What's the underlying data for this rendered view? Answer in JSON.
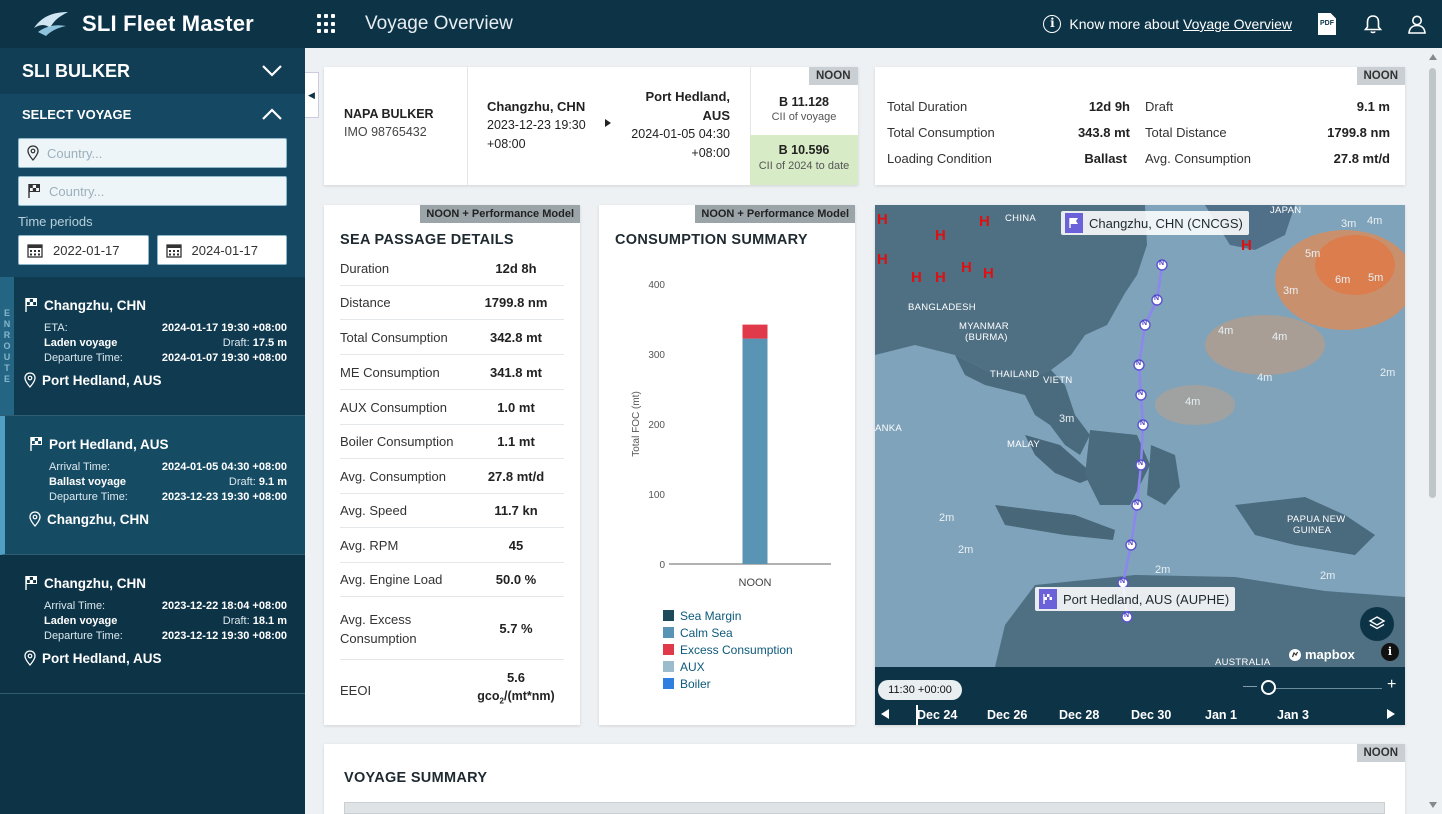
{
  "app": {
    "name": "SLI Fleet Master",
    "page_title": "Voyage Overview",
    "know_more_prefix": "Know more about",
    "know_more_link": "Voyage Overview",
    "pdf_label": "PDF"
  },
  "sidebar": {
    "vessel": "SLI BULKER",
    "select_voyage": "SELECT VOYAGE",
    "country_placeholder_1": "Country...",
    "country_placeholder_2": "Country...",
    "time_periods_label": "Time periods",
    "date_from": "2022-01-17",
    "date_to": "2024-01-17",
    "enroute_letters": [
      "E",
      "N",
      "R",
      "O",
      "U",
      "T",
      "E"
    ],
    "voyages": [
      {
        "origin": "Changzhu, CHN",
        "row1_label": "ETA:",
        "row1_value": "2024-01-17 19:30 +08:00",
        "condition": "Laden voyage",
        "draft_label": "Draft:",
        "draft_value": "17.5 m",
        "dep_label": "Departure Time:",
        "dep_value": "2024-01-07 19:30 +08:00",
        "destination": "Port Hedland, AUS"
      },
      {
        "origin": "Port Hedland, AUS",
        "row1_label": "Arrival Time:",
        "row1_value": "2024-01-05 04:30 +08:00",
        "condition": "Ballast voyage",
        "draft_label": "Draft:",
        "draft_value": "9.1 m",
        "dep_label": "Departure Time:",
        "dep_value": "2023-12-23 19:30 +08:00",
        "destination": "Changzhu, CHN"
      },
      {
        "origin": "Changzhu, CHN",
        "row1_label": "Arrival Time:",
        "row1_value": "2023-12-22 18:04 +08:00",
        "condition": "Laden voyage",
        "draft_label": "Draft:",
        "draft_value": "18.1 m",
        "dep_label": "Departure Time:",
        "dep_value": "2023-12-12 19:30 +08:00",
        "destination": "Port Hedland, AUS"
      }
    ]
  },
  "voyage_header": {
    "tag": "NOON",
    "ship_name": "NAPA BULKER",
    "imo": "IMO 98765432",
    "from_port": "Changzhu, CHN",
    "from_time": "2023-12-23 19:30",
    "from_tz": "+08:00",
    "to_port_1": "Port Hedland,",
    "to_port_2": "AUS",
    "to_time": "2024-01-05 04:30",
    "to_tz": "+08:00",
    "cii_voyage_value": "B 11.128",
    "cii_voyage_label": "CII of voyage",
    "cii_year_value": "B 10.596",
    "cii_year_label": "CII of 2024 to date"
  },
  "summary": {
    "tag": "NOON",
    "total_duration_label": "Total Duration",
    "total_duration": "12d 9h",
    "draft_label": "Draft",
    "draft": "9.1 m",
    "total_consumption_label": "Total Consumption",
    "total_consumption": "343.8 mt",
    "total_distance_label": "Total Distance",
    "total_distance": "1799.8 nm",
    "loading_condition_label": "Loading Condition",
    "loading_condition": "Ballast",
    "avg_consumption_label": "Avg. Consumption",
    "avg_consumption": "27.8 mt/d"
  },
  "sea_passage": {
    "tag": "NOON + Performance Model",
    "title": "SEA PASSAGE DETAILS",
    "rows": [
      {
        "label": "Duration",
        "value": "12d 8h"
      },
      {
        "label": "Distance",
        "value": "1799.8 nm"
      },
      {
        "label": "Total Consumption",
        "value": "342.8 mt"
      },
      {
        "label": "ME Consumption",
        "value": "341.8 mt"
      },
      {
        "label": "AUX Consumption",
        "value": "1.0 mt"
      },
      {
        "label": "Boiler Consumption",
        "value": "1.1 mt"
      },
      {
        "label": "Avg. Consumption",
        "value": "27.8 mt/d"
      },
      {
        "label": "Avg. Speed",
        "value": "11.7 kn"
      },
      {
        "label": "Avg. RPM",
        "value": "45"
      },
      {
        "label": "Avg. Engine Load",
        "value": "50.0 %"
      },
      {
        "label": "Avg. Excess Consumption",
        "value": "5.7 %"
      }
    ],
    "eeoi_label": "EEOI",
    "eeoi_value": "5.6",
    "eeoi_unit_a": "gco",
    "eeoi_unit_sub": "2",
    "eeoi_unit_b": "/(mt*nm)"
  },
  "consumption": {
    "tag": "NOON + Performance Model",
    "title": "CONSUMPTION SUMMARY",
    "legend": [
      {
        "name": "Sea Margin",
        "color": "#1d4a5a"
      },
      {
        "name": "Calm Sea",
        "color": "#5a94b4"
      },
      {
        "name": "Excess Consumption",
        "color": "#e03a4a"
      },
      {
        "name": "AUX",
        "color": "#9bbccc"
      },
      {
        "name": "Boiler",
        "color": "#2f7fe0"
      }
    ]
  },
  "chart_data": {
    "type": "bar",
    "categories": [
      "NOON"
    ],
    "ylabel": "Total FOC (mt)",
    "ylim": [
      0,
      400
    ],
    "yticks": [
      0,
      100,
      200,
      300,
      400
    ],
    "stacked": true,
    "series": [
      {
        "name": "Calm Sea",
        "values": [
          322
        ],
        "color": "#5a94b4"
      },
      {
        "name": "Excess Consumption",
        "values": [
          20
        ],
        "color": "#e03a4a"
      }
    ]
  },
  "map": {
    "origin_label": "Changzhu, CHN (CNCGS)",
    "dest_label": "Port Hedland, AUS (AUPHE)",
    "geo": [
      "CHINA",
      "BANGLADESH",
      "MYANMAR",
      "(BURMA)",
      "THAILAND",
      "VIETN",
      "MALAY",
      "ANKA",
      "PAPUA NEW",
      "GUINEA",
      "JAPAN",
      "AUSTRALIA"
    ],
    "waves": [
      "3m",
      "4m",
      "5m",
      "6m",
      "5m",
      "3m",
      "4m",
      "4m",
      "2m",
      "4m",
      "3m",
      "2m",
      "2m",
      "2m",
      "2m",
      "4m"
    ],
    "time_pill": "11:30 +00:00",
    "dates": [
      "Dec 24",
      "Dec 26",
      "Dec 28",
      "Dec 30",
      "Jan 1",
      "Jan 3"
    ],
    "attribution": "mapbox",
    "route_marker": "N"
  },
  "voyage_summary": {
    "tag": "NOON",
    "title": "VOYAGE SUMMARY"
  }
}
